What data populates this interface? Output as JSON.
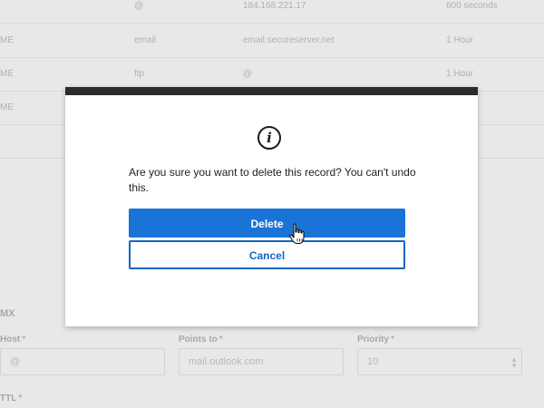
{
  "dns_rows": [
    {
      "type": "",
      "host": "@",
      "points_to": "184.168.221.17",
      "ttl": "600 seconds"
    },
    {
      "type": "ME",
      "host": "email",
      "points_to": "email.secureserver.net",
      "ttl": "1 Hour"
    },
    {
      "type": "ME",
      "host": "ftp",
      "points_to": "@",
      "ttl": "1 Hour"
    },
    {
      "type": "ME",
      "host": "",
      "points_to": "",
      "ttl": ""
    }
  ],
  "form": {
    "section_title": "MX",
    "host_label": "Host",
    "host_value": "@",
    "points_label": "Points to",
    "points_placeholder": "mail.outlook.com",
    "priority_label": "Priority",
    "priority_value": "10",
    "ttl_label": "TTL",
    "required_mark": "*"
  },
  "dialog": {
    "icon": "info-icon",
    "icon_glyph": "i",
    "message": "Are you sure you want to delete this record? You can't undo this.",
    "delete_label": "Delete",
    "cancel_label": "Cancel",
    "colors": {
      "primary": "#1a74d8",
      "cancel_text": "#1565c0",
      "bar": "#2b2b2b"
    }
  }
}
